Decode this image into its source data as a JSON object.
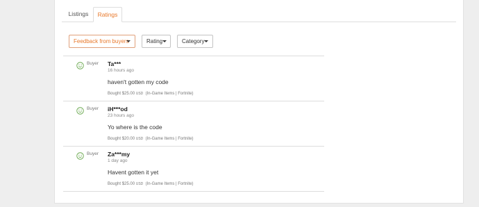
{
  "tabs": [
    {
      "label": "Listings",
      "active": false
    },
    {
      "label": "Ratings",
      "active": true
    }
  ],
  "filters": {
    "feedback_label": "Feedback from buyers",
    "rating_label": "Rating",
    "category_label": "Category"
  },
  "colors": {
    "accent": "#e8782a",
    "positive": "#6aa84f"
  },
  "reviews": [
    {
      "role": "Buyer",
      "icon": "smiley-face-icon",
      "name": "Ta***",
      "time": "16 hours ago",
      "comment": "haven't gotten my code",
      "bought_prefix": "Bought",
      "amount": "$25.00",
      "currency": "USD",
      "category": "(In-Game Items | Fortnite)"
    },
    {
      "role": "Buyer",
      "icon": "smiley-face-icon",
      "name": "iH***od",
      "time": "23 hours ago",
      "comment": "Yo where is the code",
      "bought_prefix": "Bought",
      "amount": "$20.00",
      "currency": "USD",
      "category": "(In-Game Items | Fortnite)"
    },
    {
      "role": "Buyer",
      "icon": "smiley-face-icon",
      "name": "Za***my",
      "time": "1 day ago",
      "comment": "Havent gotten it yet",
      "bought_prefix": "Bought",
      "amount": "$25.00",
      "currency": "USD",
      "category": "(In-Game Items | Fortnite)"
    }
  ]
}
